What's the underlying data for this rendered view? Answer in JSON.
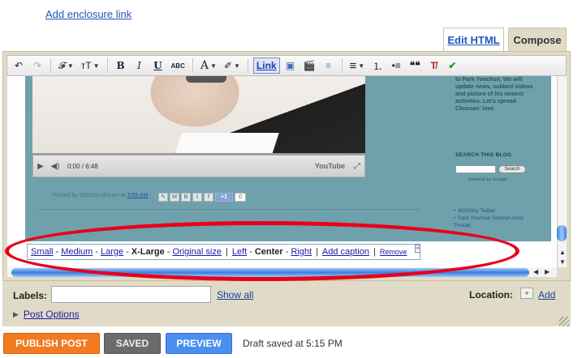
{
  "enclosure_link": "Add enclosure link",
  "tabs": {
    "edit_html": "Edit HTML",
    "compose": "Compose"
  },
  "toolbar": {
    "undo": "↶",
    "redo": "↷",
    "font": "𝓕",
    "font_size": "тT",
    "bold": "B",
    "italic": "I",
    "underline": "U",
    "strike": "ABC",
    "text_color": "A",
    "highlight": "✐",
    "link": "Link",
    "image": "▣",
    "video": "🎬",
    "jump_break": "≡",
    "align": "≡",
    "numbered_list": "⒈",
    "bullet_list": "•≡",
    "quote": "❝❝",
    "clear": "T̸",
    "spellcheck": "✔"
  },
  "blog_preview": {
    "sidebar_text": "to Park Yoochun. We will update news, subbed videos and picture of his newest activities. Let's spread Chunsas' love.",
    "sidebar_search_title": "SEARCH THIS BLOG",
    "search_button": "Search",
    "powered_by": "powered by Google",
    "sidebar_links": [
      "6002Sky Twitter",
      "Park Yoochun Soompi Actor Thread"
    ],
    "video_time": "0:00 / 6:48",
    "video_brand": "YouTube",
    "posted_by": "Posted by 6002sky@team at",
    "posted_time": "3:55 AM",
    "plus_one": "+1",
    "plus_count": "0"
  },
  "image_bar": {
    "small": "Small",
    "medium": "Medium",
    "large": "Large",
    "xlarge": "X-Large",
    "original": "Original size",
    "left": "Left",
    "center": "Center",
    "right": "Right",
    "add_caption": "Add caption",
    "remove": "Remove",
    "close": "×"
  },
  "labels": {
    "label": "Labels:",
    "value": "",
    "show_all": "Show all"
  },
  "location": {
    "label": "Location:",
    "add": "Add"
  },
  "post_options": "Post Options",
  "buttons": {
    "publish": "PUBLISH POST",
    "saved": "SAVED",
    "preview": "PREVIEW"
  },
  "draft_status": "Draft saved at 5:15 PM",
  "colors": {
    "publish": "#f27a20",
    "preview": "#4a8ef0",
    "saved": "#6b6b6b",
    "highlight_ring": "#e8001a",
    "panel": "#e0dbc6"
  }
}
